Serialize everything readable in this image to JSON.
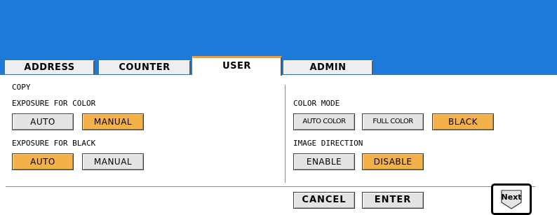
{
  "tabs": [
    {
      "label": "ADDRESS"
    },
    {
      "label": "COUNTER"
    },
    {
      "label": "USER"
    },
    {
      "label": "ADMIN"
    }
  ],
  "section_title": "COPY",
  "exposure_color": {
    "label": "EXPOSURE FOR COLOR",
    "options": [
      {
        "label": "AUTO",
        "selected": false
      },
      {
        "label": "MANUAL",
        "selected": true
      }
    ]
  },
  "exposure_black": {
    "label": "EXPOSURE FOR BLACK",
    "options": [
      {
        "label": "AUTO",
        "selected": true
      },
      {
        "label": "MANUAL",
        "selected": false
      }
    ]
  },
  "color_mode": {
    "label": "COLOR MODE",
    "options": [
      {
        "label": "AUTO COLOR",
        "selected": false
      },
      {
        "label": "FULL COLOR",
        "selected": false
      },
      {
        "label": "BLACK",
        "selected": true
      }
    ]
  },
  "image_direction": {
    "label": "IMAGE DIRECTION",
    "options": [
      {
        "label": "ENABLE",
        "selected": false
      },
      {
        "label": "DISABLE",
        "selected": true
      }
    ]
  },
  "actions": {
    "cancel": "CANCEL",
    "enter": "ENTER",
    "next": "Next"
  },
  "colors": {
    "header": "#1e7ad8",
    "selected": "#f4b14a",
    "button": "#e4e4e4",
    "tab_accent": "#f0a030"
  }
}
